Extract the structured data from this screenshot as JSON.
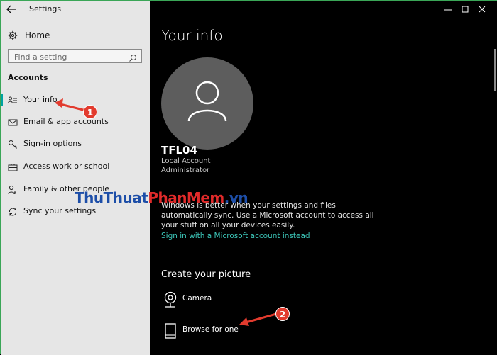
{
  "window": {
    "title": "Settings",
    "controls": [
      "minimize-icon",
      "maximize-icon",
      "close-icon"
    ]
  },
  "sidebar": {
    "home_label": "Home",
    "search_placeholder": "Find a setting",
    "section_title": "Accounts",
    "items": [
      {
        "label": "Your info",
        "icon": "person-card-icon",
        "active": true
      },
      {
        "label": "Email & app accounts",
        "icon": "mail-icon"
      },
      {
        "label": "Sign-in options",
        "icon": "key-icon"
      },
      {
        "label": "Access work or school",
        "icon": "briefcase-icon"
      },
      {
        "label": "Family & other people",
        "icon": "person-plus-icon"
      },
      {
        "label": "Sync your settings",
        "icon": "sync-icon"
      }
    ]
  },
  "main": {
    "title": "Your info",
    "user": {
      "name": "TFL04",
      "account_type": "Local Account",
      "role": "Administrator"
    },
    "sync_text": "Windows is better when your settings and files automatically sync. Use a Microsoft account to access all your stuff on all your devices easily.",
    "ms_link": "Sign in with a Microsoft account instead",
    "create_picture": {
      "heading": "Create your picture",
      "options": [
        {
          "label": "Camera",
          "icon": "camera-icon"
        },
        {
          "label": "Browse for one",
          "icon": "document-icon"
        }
      ]
    }
  },
  "annotations": {
    "watermark_part1": "ThuThuat",
    "watermark_part2": "PhanMem",
    "watermark_part3": ".vn",
    "step1": "1",
    "step2": "2"
  },
  "colors": {
    "accent": "#00a2a2",
    "link": "#3cc6b9",
    "annotation_red": "#e23b2e",
    "sidebar_bg": "#e6e6e6",
    "main_bg": "#000000"
  }
}
